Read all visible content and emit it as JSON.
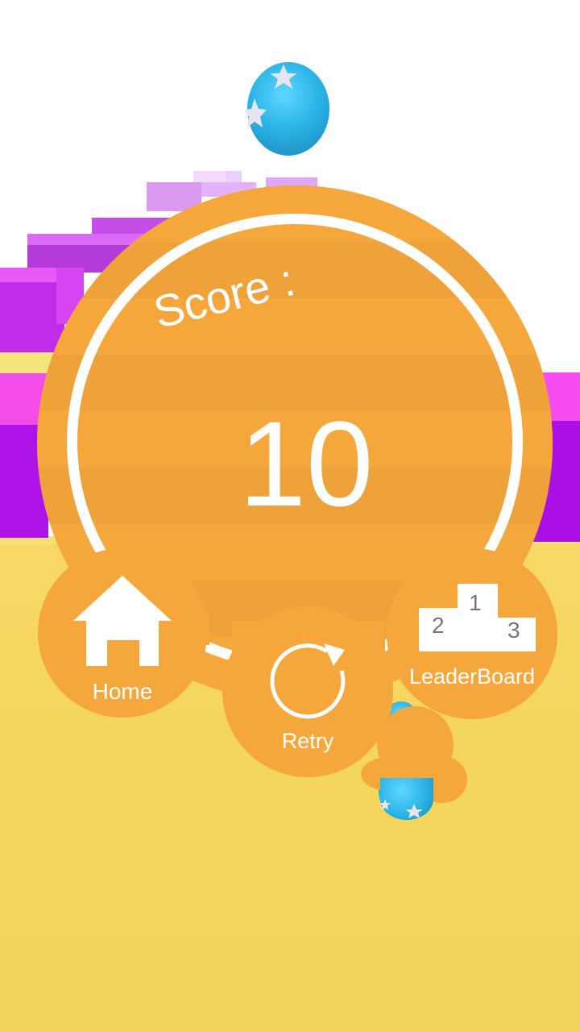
{
  "hud": {
    "score_label": "Score :",
    "score_value": "10"
  },
  "buttons": {
    "home_label": "Home",
    "retry_label": "Retry",
    "leaderboard_label": "LeaderBoard"
  },
  "podium": {
    "first": "1",
    "second": "2",
    "third": "3"
  },
  "colors": {
    "panel": "#f6a73b",
    "ball": "#2bb4e8",
    "floor": "#f4d65e",
    "blocks_purple": "#b020e0",
    "blocks_magenta": "#f040ff"
  },
  "icons": [
    "home-icon",
    "retry-icon",
    "podium-icon",
    "star-icon"
  ]
}
